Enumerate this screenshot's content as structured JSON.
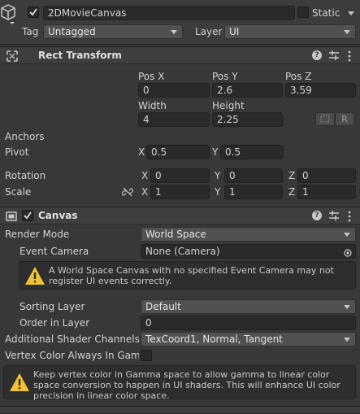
{
  "header": {
    "object_name": "2DMovieCanvas",
    "static_label": "Static",
    "tag_label": "Tag",
    "tag_value": "Untagged",
    "layer_label": "Layer",
    "layer_value": "UI"
  },
  "rect_transform": {
    "title": "Rect Transform",
    "pos_x_label": "Pos X",
    "pos_y_label": "Pos Y",
    "pos_z_label": "Pos Z",
    "pos_x": "0",
    "pos_y": "2.6",
    "pos_z": "3.59",
    "width_label": "Width",
    "height_label": "Height",
    "width": "4",
    "height": "2.25",
    "r_button": "R",
    "anchors_label": "Anchors",
    "pivot_label": "Pivot",
    "pivot_x": "0.5",
    "pivot_y": "0.5",
    "rotation_label": "Rotation",
    "rot_x": "0",
    "rot_y": "0",
    "rot_z": "0",
    "scale_label": "Scale",
    "scale_x": "1",
    "scale_y": "1",
    "scale_z": "1",
    "x_letter": "X",
    "y_letter": "Y",
    "z_letter": "Z"
  },
  "canvas": {
    "title": "Canvas",
    "render_mode_label": "Render Mode",
    "render_mode_value": "World Space",
    "event_camera_label": "Event Camera",
    "event_camera_value": "None (Camera)",
    "warning_text": "A World Space Canvas with no specified Event Camera may not register UI events correctly.",
    "sorting_layer_label": "Sorting Layer",
    "sorting_layer_value": "Default",
    "order_in_layer_label": "Order in Layer",
    "order_in_layer_value": "0",
    "shader_channels_label": "Additional Shader Channels",
    "shader_channels_value": "TexCoord1, Normal, Tangent",
    "vertex_color_label": "Vertex Color Always In Gamm",
    "info_text": "Keep vertex color in Gamma space to allow gamma to linear color space conversion to happen in UI shaders. This will enhance UI color precision in linear color space."
  }
}
